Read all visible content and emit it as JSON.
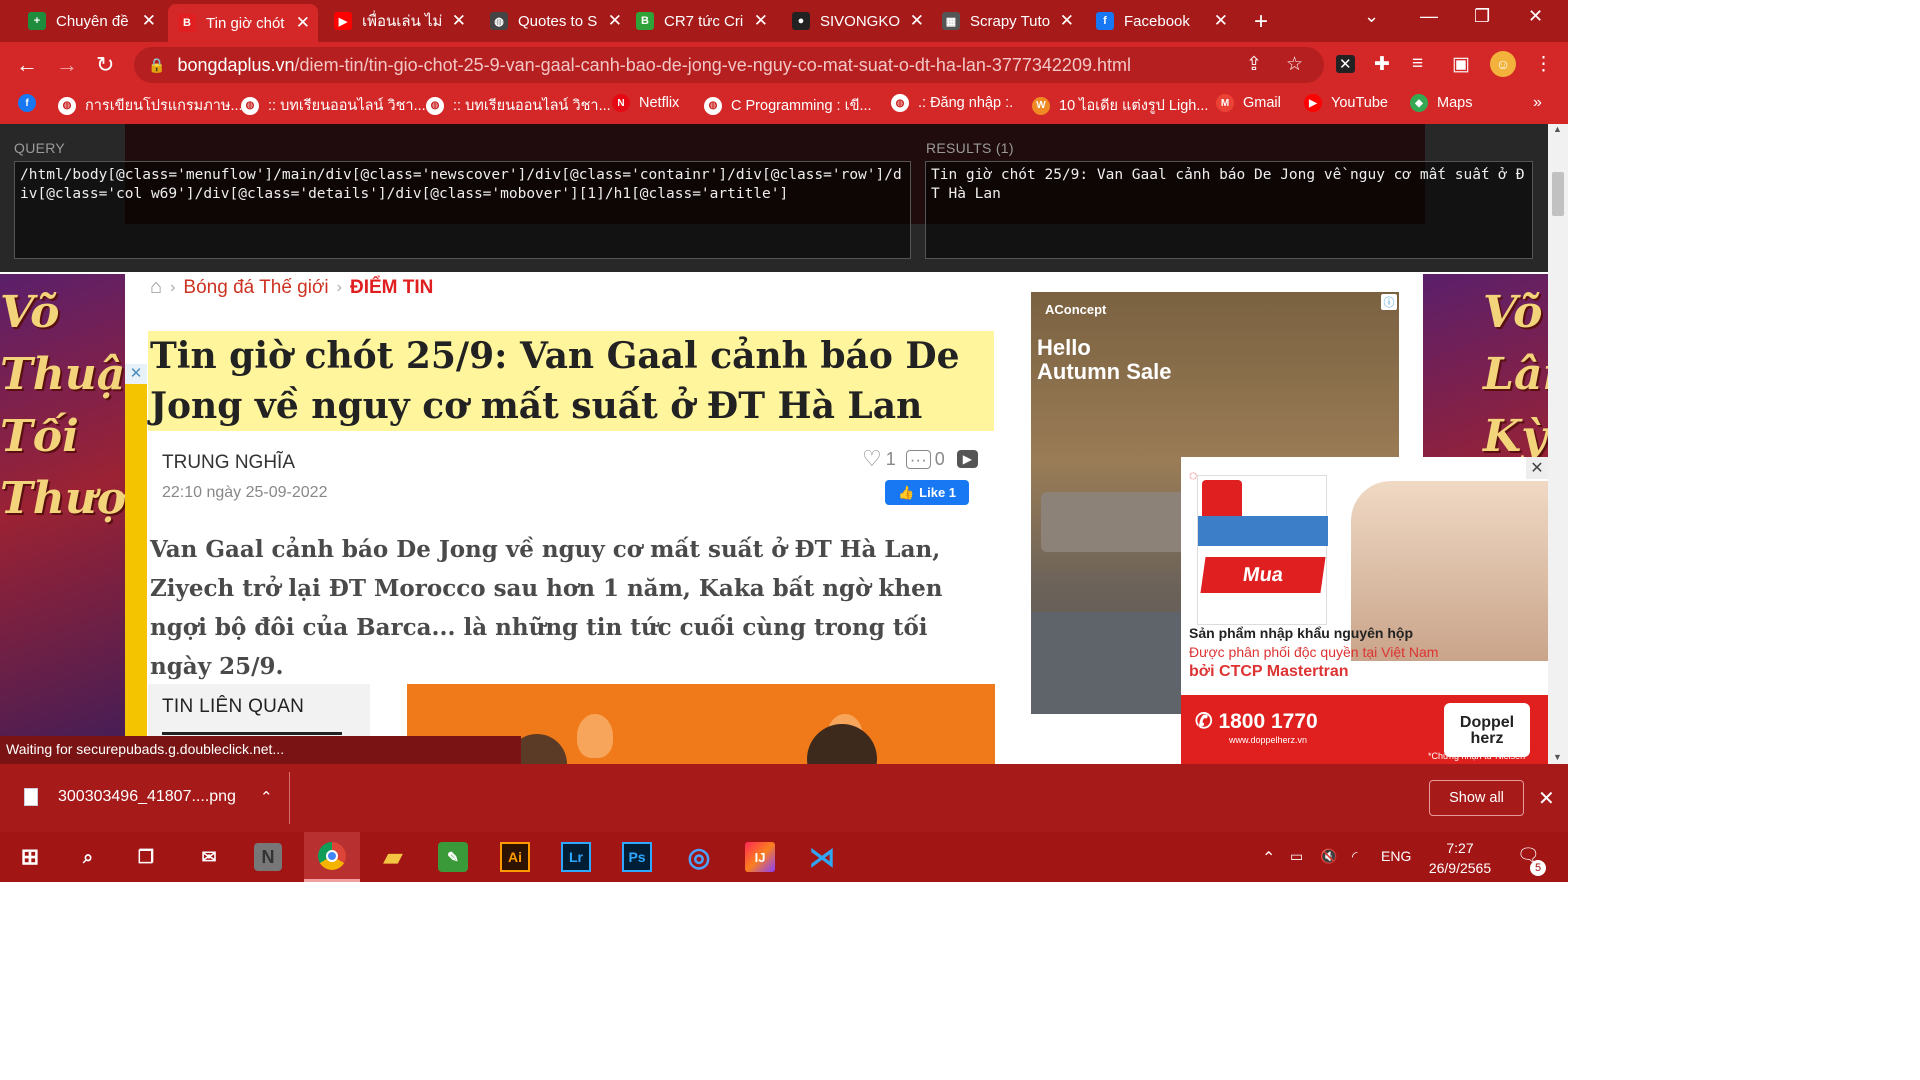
{
  "browser": {
    "tabs": [
      {
        "title": "Chuyên đề",
        "icon": "sheets-plus-icon",
        "color": "#1e8e3e",
        "glyph": "+"
      },
      {
        "title": "Tin giờ chót",
        "icon": "bongdaplus-icon",
        "color": "#e02020",
        "glyph": "B",
        "active": true
      },
      {
        "title": "เพื่อนเล่น ไม่",
        "icon": "youtube-icon",
        "color": "#ff0000",
        "glyph": "▶"
      },
      {
        "title": "Quotes to S",
        "icon": "globe-icon",
        "color": "#444",
        "glyph": "◍"
      },
      {
        "title": "CR7 tức Cri",
        "icon": "b-letter-icon",
        "color": "#2fa33a",
        "glyph": "B"
      },
      {
        "title": "SIVONGKO",
        "icon": "github-icon",
        "color": "#222",
        "glyph": "●"
      },
      {
        "title": "Scrapy Tuto",
        "icon": "doc-icon",
        "color": "#555",
        "glyph": "▦"
      },
      {
        "title": "Facebook",
        "icon": "facebook-icon",
        "color": "#1877f2",
        "glyph": "f"
      }
    ],
    "url_host": "bongdaplus.vn",
    "url_path": "/diem-tin/tin-gio-chot-25-9-van-gaal-canh-bao-de-jong-ve-nguy-co-mat-suat-o-dt-ha-lan-3777342209.html",
    "bookmarks": [
      {
        "label": "",
        "icon": "facebook-icon",
        "color": "#1877f2",
        "glyph": "f"
      },
      {
        "label": "การเขียนโปรแกรมภาษ...",
        "icon": "globe-icon",
        "color": "#fff",
        "glyph": "◍"
      },
      {
        "label": ":: บทเรียนออนไลน์ วิชา...",
        "icon": "globe-icon",
        "color": "#fff",
        "glyph": "◍"
      },
      {
        "label": ":: บทเรียนออนไลน์ วิชา...",
        "icon": "globe-icon",
        "color": "#fff",
        "glyph": "◍"
      },
      {
        "label": "Netflix",
        "icon": "netflix-icon",
        "color": "#e50914",
        "glyph": "N"
      },
      {
        "label": "C Programming : เขี...",
        "icon": "globe-icon",
        "color": "#fff",
        "glyph": "◍"
      },
      {
        "label": ".: Đăng nhập :.",
        "icon": "globe-icon",
        "color": "#fff",
        "glyph": "◍"
      },
      {
        "label": "10 ไอเดีย แต่งรูป Ligh...",
        "icon": "w-icon",
        "color": "#f08a24",
        "glyph": "W"
      },
      {
        "label": "Gmail",
        "icon": "gmail-icon",
        "color": "#ea4335",
        "glyph": "M"
      },
      {
        "label": "YouTube",
        "icon": "youtube-icon",
        "color": "#ff0000",
        "glyph": "▶"
      },
      {
        "label": "Maps",
        "icon": "maps-icon",
        "color": "#34a853",
        "glyph": "◆"
      }
    ]
  },
  "xpath_helper": {
    "query_label": "QUERY",
    "results_label": "RESULTS (1)",
    "query": "/html/body[@class='menuflow']/main/div[@class='newscover']/div[@class='containr']/div[@class='row']/div[@class='col w69']/div[@class='details']/div[@class='mobover'][1]/h1[@class='artitle']",
    "result": "Tin giờ chót 25/9: Van Gaal cảnh báo De Jong về nguy cơ mất suất ở ĐT Hà Lan"
  },
  "article": {
    "crumb_section": "Bóng đá Thế giới",
    "crumb_current": "ĐIỂM TIN",
    "title": "Tin giờ chót 25/9: Van Gaal cảnh báo De Jong về nguy cơ mất suất ở ĐT Hà Lan",
    "author": "TRUNG NGHĨA",
    "date": "22:10 ngày 25-09-2022",
    "likes": "1",
    "comments": "0",
    "fb_like": "Like 1",
    "sapo": "Van Gaal cảnh báo De Jong về nguy cơ mất suất ở ĐT Hà Lan, Ziyech trở lại ĐT Morocco sau hơn 1 năm, Kaka bất ngờ khen ngợi bộ đôi của Barca... là những tin tức cuối cùng trong tối ngày 25/9.",
    "related_title": "TIN LIÊN QUAN"
  },
  "left_banner_text": [
    "Võ",
    "Thuật",
    "Tối",
    "Thượng"
  ],
  "right_banner_text": [
    "Võ",
    "Lâm",
    "Kỳ"
  ],
  "right_ad": {
    "brand": "AConcept",
    "headline_1": "Hello",
    "headline_2": "Autumn Sale"
  },
  "popup_ad": {
    "cta": "Mua",
    "line1": "Sản phẩm nhập khẩu nguyên hộp",
    "line2": "Được phân phối độc quyền tại Việt Nam",
    "line3": "bởi CTCP Mastertran",
    "phone": "1800 1770",
    "website": "www.doppelherz.vn",
    "brand_1": "Doppel",
    "brand_2": "herz",
    "note": "*Chứng nhận từ Nielsen"
  },
  "status_text": "Waiting for securepubads.g.doubleclick.net...",
  "downloads": {
    "file": "300303496_41807....png",
    "show_all": "Show all"
  },
  "taskbar": {
    "lang": "ENG",
    "time": "7:27",
    "date": "26/9/2565",
    "notif_count": "5"
  }
}
